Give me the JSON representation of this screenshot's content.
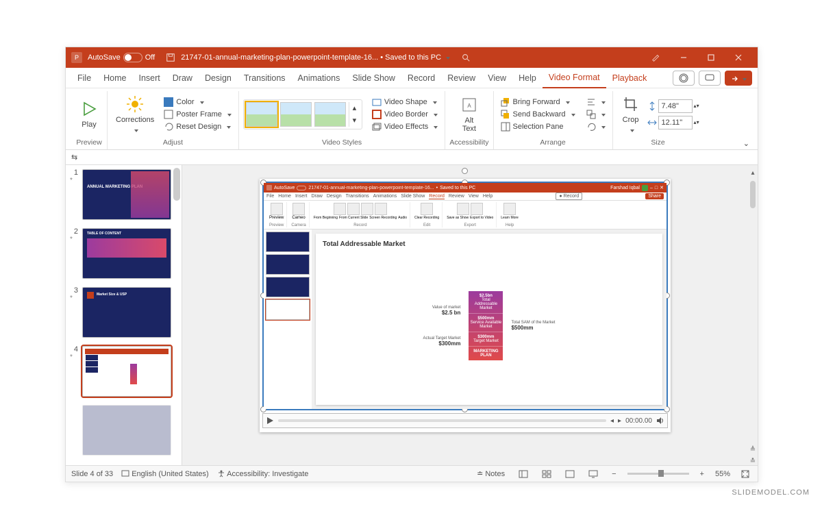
{
  "titlebar": {
    "autosave_label": "AutoSave",
    "autosave_state": "Off",
    "document_name": "21747-01-annual-marketing-plan-powerpoint-template-16...",
    "save_status": "Saved to this PC"
  },
  "tabs": {
    "list": [
      {
        "label": "File"
      },
      {
        "label": "Home"
      },
      {
        "label": "Insert"
      },
      {
        "label": "Draw"
      },
      {
        "label": "Design"
      },
      {
        "label": "Transitions"
      },
      {
        "label": "Animations"
      },
      {
        "label": "Slide Show"
      },
      {
        "label": "Record"
      },
      {
        "label": "Review"
      },
      {
        "label": "View"
      },
      {
        "label": "Help"
      }
    ],
    "context": [
      {
        "label": "Video Format",
        "active": true
      },
      {
        "label": "Playback"
      }
    ]
  },
  "ribbon": {
    "preview": {
      "play": "Play",
      "label": "Preview"
    },
    "adjust": {
      "corrections": "Corrections",
      "color": "Color",
      "poster_frame": "Poster Frame",
      "reset_design": "Reset Design",
      "label": "Adjust"
    },
    "video_styles": {
      "video_shape": "Video Shape",
      "video_border": "Video Border",
      "video_effects": "Video Effects",
      "label": "Video Styles"
    },
    "accessibility": {
      "alt_text": "Alt\nText",
      "label": "Accessibility"
    },
    "arrange": {
      "bring_forward": "Bring Forward",
      "send_backward": "Send Backward",
      "selection_pane": "Selection Pane",
      "label": "Arrange"
    },
    "size": {
      "crop": "Crop",
      "height": "7.48\"",
      "width": "12.11\"",
      "label": "Size"
    }
  },
  "thumbnails": [
    {
      "num": "1",
      "title": "ANNUAL MARKETING PLAN"
    },
    {
      "num": "2",
      "title": "TABLE OF CONTENT"
    },
    {
      "num": "3",
      "title": "Market Size & USP"
    },
    {
      "num": "4",
      "title": "",
      "selected": true
    }
  ],
  "embedded": {
    "titlebar": {
      "autosave": "AutoSave",
      "doc": "21747-01-annual-marketing-plan-powerpoint-template-16...",
      "status": "Saved to this PC",
      "user": "Farshad Iqbal",
      "record_btn": "Record",
      "share_btn": "Share"
    },
    "tabs": [
      "File",
      "Home",
      "Insert",
      "Draw",
      "Design",
      "Transitions",
      "Animations",
      "Slide Show",
      "Record",
      "Review",
      "View",
      "Help"
    ],
    "active_tab": "Record",
    "ribbon_groups": [
      {
        "items": [
          "Preview"
        ],
        "label": "Preview"
      },
      {
        "items": [
          "Cameo"
        ],
        "label": "Camera"
      },
      {
        "items": [
          "From Beginning",
          "From Current Slide",
          "Screen Recording",
          "Audio"
        ],
        "label": "Record"
      },
      {
        "items": [
          "Clear Recording"
        ],
        "label": "Edit"
      },
      {
        "items": [
          "Save as Show",
          "Export to Video"
        ],
        "label": "Export"
      },
      {
        "items": [
          "Learn More"
        ],
        "label": "Help"
      }
    ],
    "slide": {
      "title": "Total Addressable Market",
      "left": [
        {
          "label": "Value of market",
          "value": "$2.5 bn"
        },
        {
          "label": "Actual Target Market",
          "value": "$300mm"
        }
      ],
      "column": [
        {
          "value": "$2.5bn",
          "desc": "Total Addressable Market"
        },
        {
          "value": "$500mm",
          "desc": "Service Available Market"
        },
        {
          "value": "$300mm",
          "desc": "Target Market"
        },
        {
          "value": "MARKETING PLAN",
          "desc": ""
        }
      ],
      "right": {
        "label": "Total SAM of the Market",
        "value": "$500mm"
      }
    },
    "video_time": "00:00.00"
  },
  "status": {
    "slide_count": "Slide 4 of 33",
    "language": "English (United States)",
    "accessibility": "Accessibility: Investigate",
    "notes": "Notes",
    "zoom": "55%"
  },
  "watermark": "SLIDEMODEL.COM"
}
